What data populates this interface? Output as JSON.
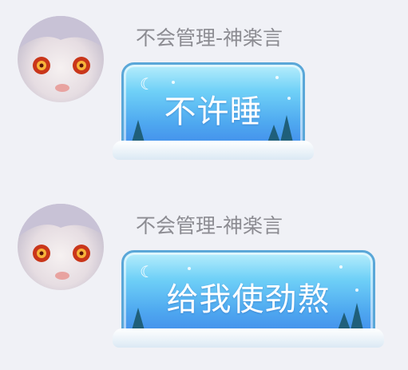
{
  "messages": [
    {
      "sender": "不会管理-神楽言",
      "text": "不许睡",
      "avatar_icon": "anime-girl-avatar"
    },
    {
      "sender": "不会管理-神楽言",
      "text": "给我使劲熬",
      "avatar_icon": "anime-girl-avatar"
    }
  ],
  "colors": {
    "background": "#f0f1f6",
    "sender_name": "#8c8c92",
    "bubble_top": "#b7eefc",
    "bubble_bottom": "#3f86ea"
  }
}
